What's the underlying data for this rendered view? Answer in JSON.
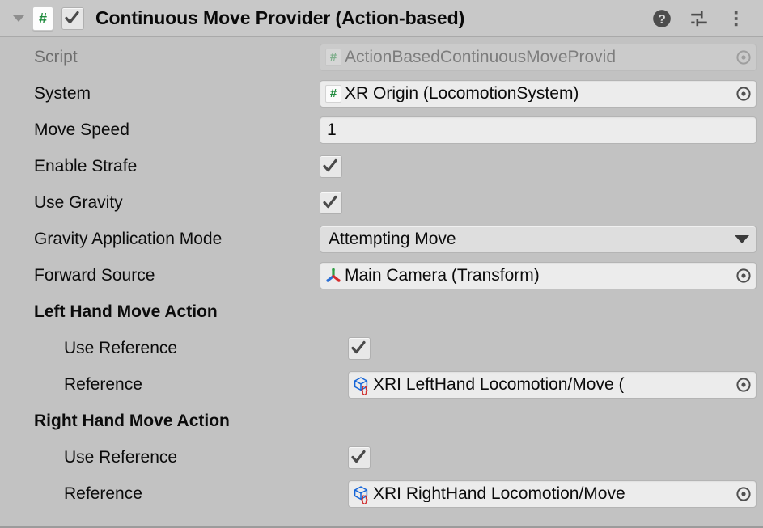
{
  "header": {
    "title": "Continuous Move Provider (Action-based)",
    "script_glyph": "#",
    "enabled": true,
    "foldout_expanded": true,
    "icons": [
      {
        "name": "help-icon",
        "label": "?"
      },
      {
        "name": "preset-icon",
        "label": "Preset"
      },
      {
        "name": "more-menu-icon",
        "label": "More"
      }
    ]
  },
  "properties": {
    "script": {
      "label": "Script",
      "value": "ActionBasedContinuousMoveProvid",
      "icon": "script-icon",
      "disabled": true
    },
    "system": {
      "label": "System",
      "value": "XR Origin (LocomotionSystem)",
      "icon": "script-icon"
    },
    "move_speed": {
      "label": "Move Speed",
      "value": "1"
    },
    "enable_strafe": {
      "label": "Enable Strafe",
      "checked": true
    },
    "use_gravity": {
      "label": "Use Gravity",
      "checked": true
    },
    "gravity_application_mode": {
      "label": "Gravity Application Mode",
      "value": "Attempting Move"
    },
    "forward_source": {
      "label": "Forward Source",
      "value": "Main Camera (Transform)",
      "icon": "transform-icon"
    },
    "left_hand_move_action": {
      "label": "Left Hand Move Action",
      "use_reference": {
        "label": "Use Reference",
        "checked": true
      },
      "reference": {
        "label": "Reference",
        "value": "XRI LeftHand Locomotion/Move (",
        "icon": "input-action-reference-icon"
      }
    },
    "right_hand_move_action": {
      "label": "Right Hand Move Action",
      "use_reference": {
        "label": "Use Reference",
        "checked": true
      },
      "reference": {
        "label": "Reference",
        "value": "XRI RightHand Locomotion/Move",
        "icon": "input-action-reference-icon"
      }
    }
  },
  "colors": {
    "panel_bg": "#c2c2c2",
    "header_bg": "#c8c8c8",
    "field_bg": "#ececec",
    "script_green": "#1f8b3d",
    "axis_red": "#d62c2c",
    "axis_green": "#2f9e44",
    "axis_blue": "#2b6fd4",
    "cube_blue": "#1565d8",
    "braces_red": "#d03030"
  }
}
